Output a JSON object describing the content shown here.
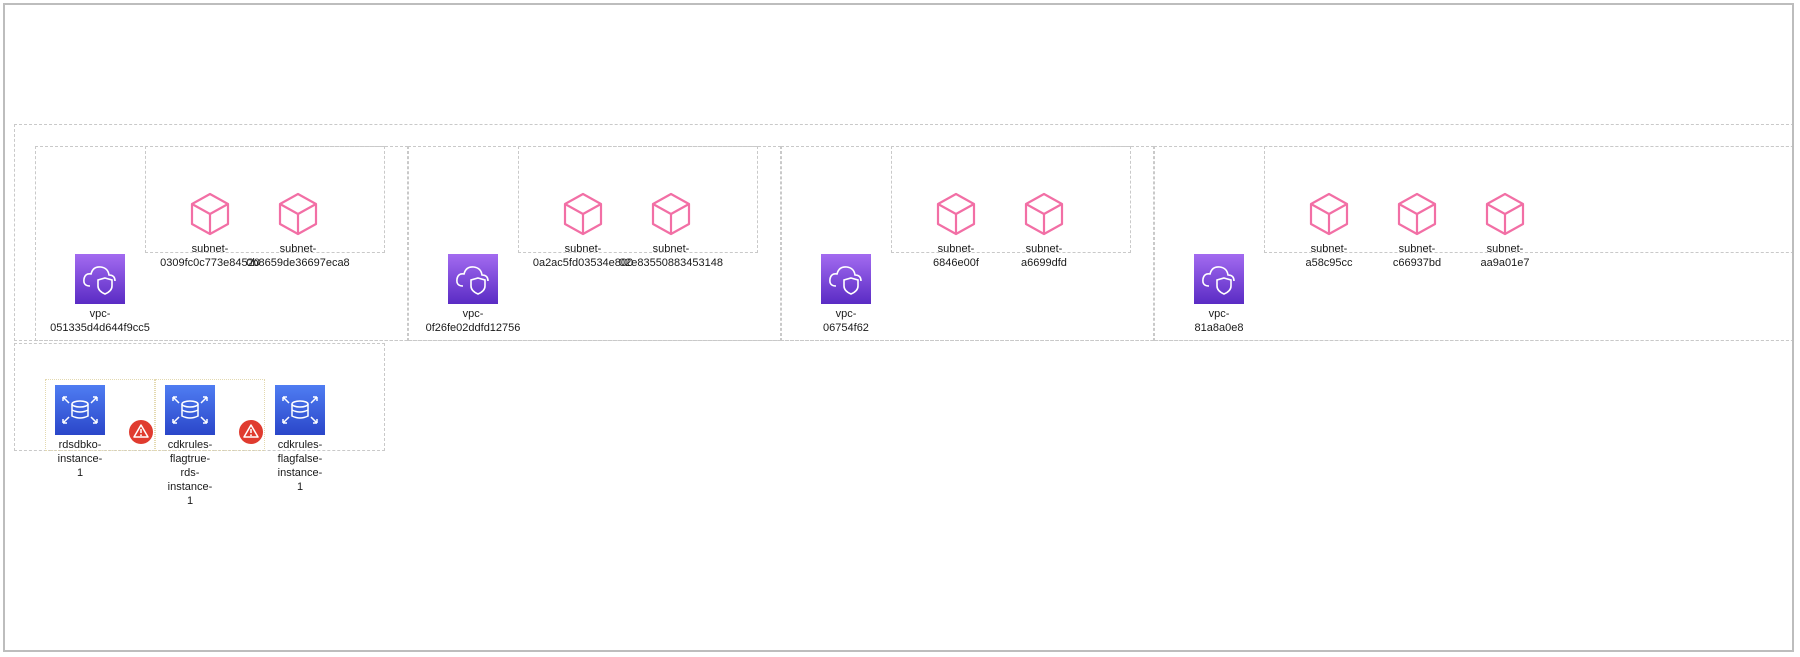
{
  "colors": {
    "subnet_icon": "#f26fa5",
    "vpc_icon_top": "#a36bf0",
    "vpc_icon_bottom": "#5a2bc4",
    "rds_icon_top": "#4f7df2",
    "rds_icon_bottom": "#2a46c9",
    "warning": "#e03b2f"
  },
  "icons": {
    "subnet": "cube-icon",
    "vpc": "cloud-shield-icon",
    "rds": "database-icon",
    "warning": "warning-icon"
  },
  "vpcs": [
    {
      "label": "vpc-\n051335d4d644f9cc5",
      "subnets": [
        {
          "label": "subnet-\n0309fc0c773e84520"
        },
        {
          "label": "subnet-\n0b8659de36697eca8"
        }
      ]
    },
    {
      "label": "vpc-\n0f26fe02ddfd12756",
      "subnets": [
        {
          "label": "subnet-\n0a2ac5fd03534e800"
        },
        {
          "label": "subnet-\n02e83550883453148"
        }
      ]
    },
    {
      "label": "vpc-\n06754f62",
      "subnets": [
        {
          "label": "subnet-\n6846e00f"
        },
        {
          "label": "subnet-\na6699dfd"
        }
      ]
    },
    {
      "label": "vpc-\n81a8a0e8",
      "subnets": [
        {
          "label": "subnet-\na58c95cc"
        },
        {
          "label": "subnet-\nc66937bd"
        },
        {
          "label": "subnet-\naa9a01e7"
        }
      ]
    }
  ],
  "rds_instances": [
    {
      "label": "rdsdbko-\ninstance-\n1",
      "warning": true
    },
    {
      "label": "cdkrules-\nflagtrue-\nrds-\ninstance-\n1",
      "warning": true
    },
    {
      "label": "cdkrules-\nflagfalse-\ninstance-\n1",
      "warning": false
    }
  ]
}
